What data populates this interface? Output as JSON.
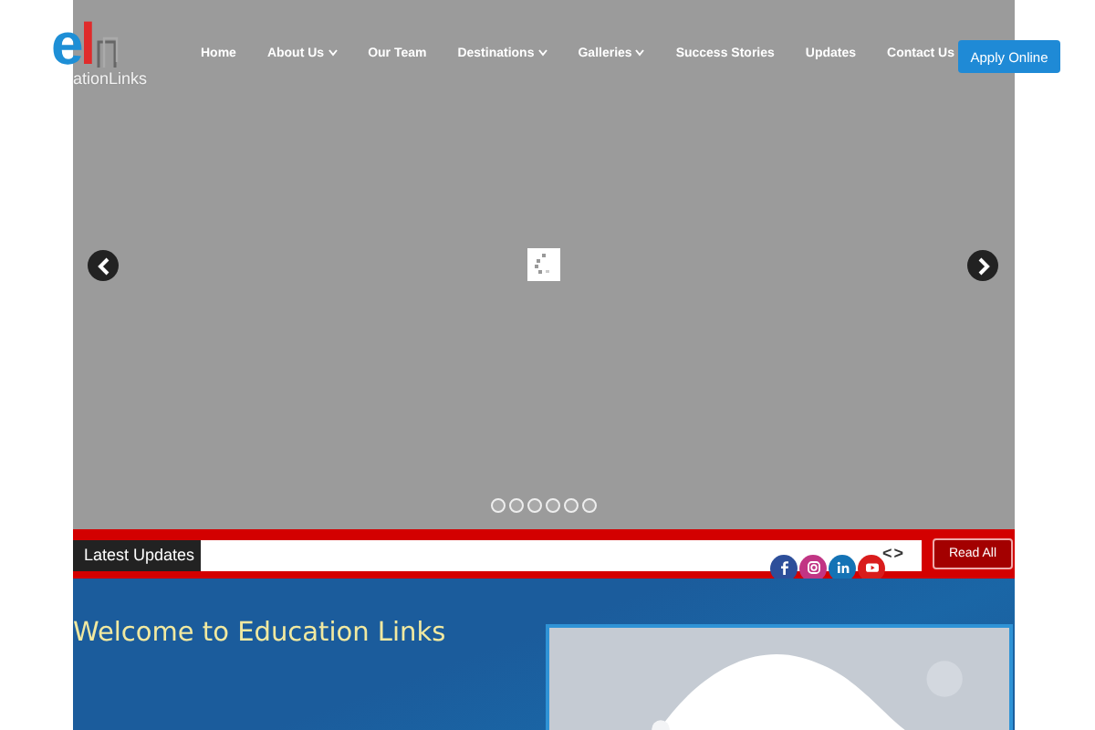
{
  "logo": {
    "letters": [
      {
        "text": "e",
        "color": "#1e8fd6"
      },
      {
        "text": "l",
        "color": "#e02b2b"
      }
    ],
    "name": "ationLinks"
  },
  "nav": [
    {
      "label": "Home",
      "has_dropdown": false
    },
    {
      "label": "About Us",
      "has_dropdown": true
    },
    {
      "label": "Our Team",
      "has_dropdown": false
    },
    {
      "label": "Destinations",
      "has_dropdown": true
    },
    {
      "label": "Galleries",
      "has_dropdown": true
    },
    {
      "label": "Success Stories",
      "has_dropdown": false
    },
    {
      "label": "Updates",
      "has_dropdown": false
    },
    {
      "label": "Contact Us",
      "has_dropdown": false
    }
  ],
  "apply_button": "Apply Online",
  "slider": {
    "dots": [
      {
        "selected": false
      },
      {
        "selected": false
      },
      {
        "selected": false
      },
      {
        "selected": false
      },
      {
        "selected": false
      },
      {
        "selected": false
      }
    ]
  },
  "updates_bar": {
    "label": "Latest Updates",
    "prev": "<",
    "next": ">",
    "read_all": "Read All"
  },
  "social": [
    {
      "kind": "facebook",
      "color": "#2d4f9a"
    },
    {
      "kind": "instagram",
      "color": "#c13584"
    },
    {
      "kind": "linkedin",
      "color": "#1473b5"
    },
    {
      "kind": "youtube",
      "color": "#d91c1c"
    }
  ],
  "welcome": {
    "heading": "Welcome to Education Links"
  }
}
